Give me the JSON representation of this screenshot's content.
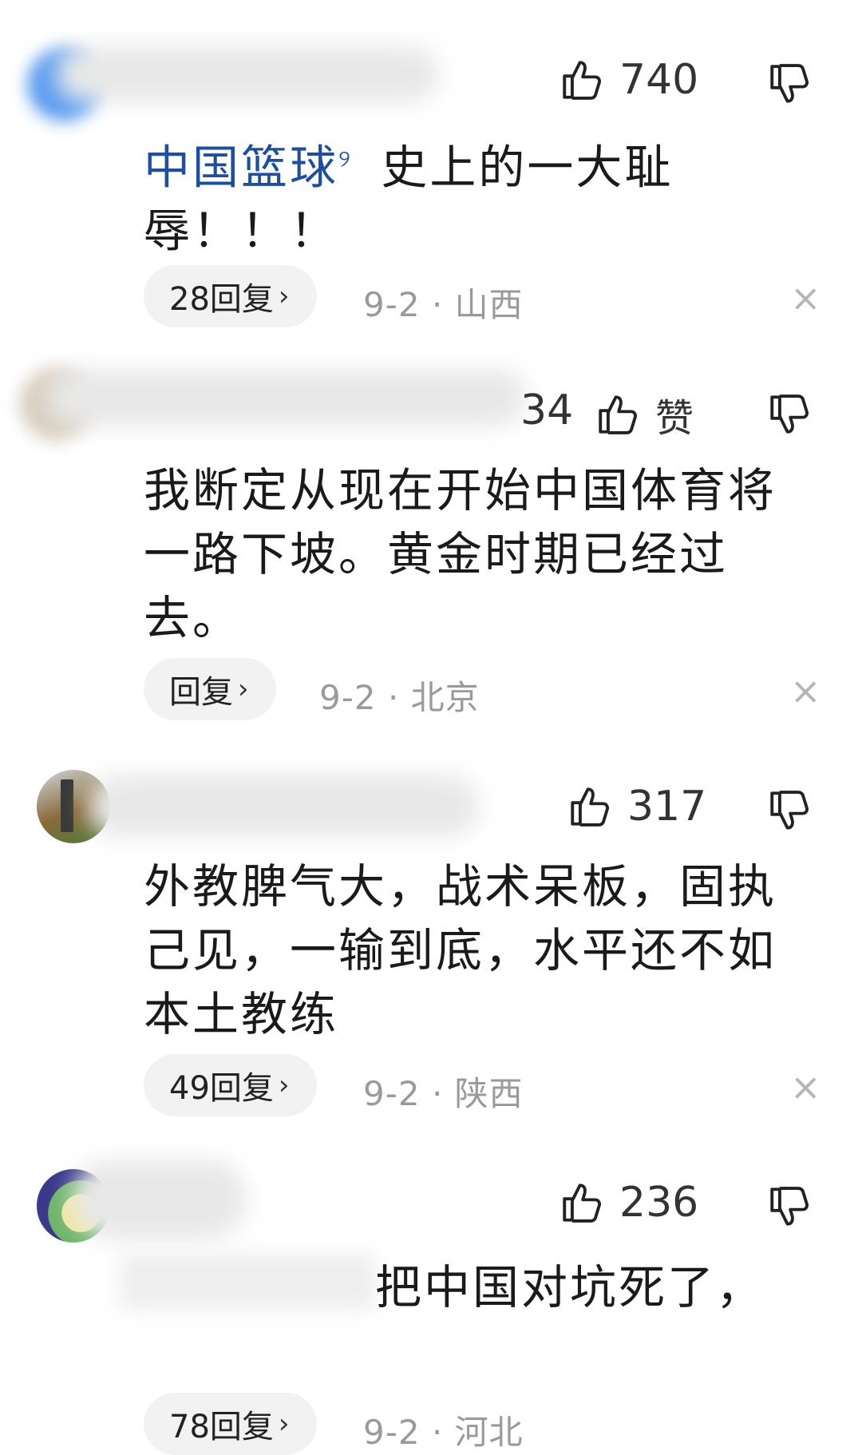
{
  "comments": [
    {
      "like_count": "740",
      "topic": "中国篮球",
      "text": " 史上的一大耻辱！！！",
      "reply_label": "28回复",
      "meta": "9-2 · 山西"
    },
    {
      "name_tail": "34",
      "like_label": "赞",
      "text": "我断定从现在开始中国体育将一路下坡。黄金时期已经过去。",
      "reply_label": "回复",
      "meta": "9-2 · 北京"
    },
    {
      "like_count": "317",
      "text": "外教脾气大，战术呆板，固执己见，一输到底，水平还不如本土教练",
      "reply_label": "49回复",
      "meta": "9-2 · 陕西"
    },
    {
      "like_count": "236",
      "text": "把中国对坑死了，",
      "reply_label": "78回复",
      "meta": "9-2 · 河北"
    }
  ],
  "icons": {
    "like": "thumbs-up-icon",
    "dislike": "thumbs-down-icon",
    "dismiss": "close-icon",
    "reply_arrow": "chevron-right-icon"
  },
  "colors": {
    "topic_link": "#1f4e9a",
    "meta_text": "#9a9a9a",
    "pill_bg": "#f2f2f2"
  }
}
